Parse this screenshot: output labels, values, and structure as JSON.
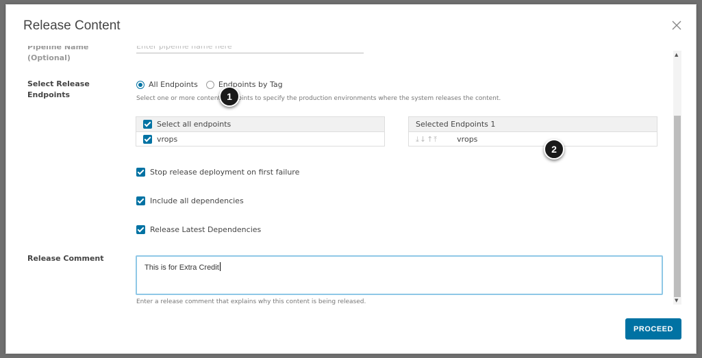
{
  "modal": {
    "title": "Release Content"
  },
  "form": {
    "pipeline_name_label": "Pipeline Name (Optional)",
    "pipeline_name_placeholder": "Enter pipeline name here",
    "endpoints_label": "Select Release Endpoints",
    "radio_all": "All Endpoints",
    "radio_by_tag": "Endpoints by Tag",
    "endpoints_hint": "Select one or more content endpoints to specify the production environments where the system releases the content.",
    "left_list_header": "Select all endpoints",
    "left_list_items": [
      "vrops"
    ],
    "right_list_header": "Selected Endpoints 1",
    "right_list_items": [
      "vrops"
    ],
    "option_stop": "Stop release deployment on first failure",
    "option_deps": "Include all dependencies",
    "option_latest": "Release Latest Dependencies",
    "comment_label": "Release Comment",
    "comment_value": "This is for Extra Credit",
    "comment_hint": "Enter a release comment that explains why this content is being released."
  },
  "footer": {
    "proceed_label": "PROCEED"
  },
  "callouts": [
    "1",
    "2"
  ],
  "colors": {
    "primary": "#0072a3",
    "focus_border": "#8ec7e6"
  }
}
